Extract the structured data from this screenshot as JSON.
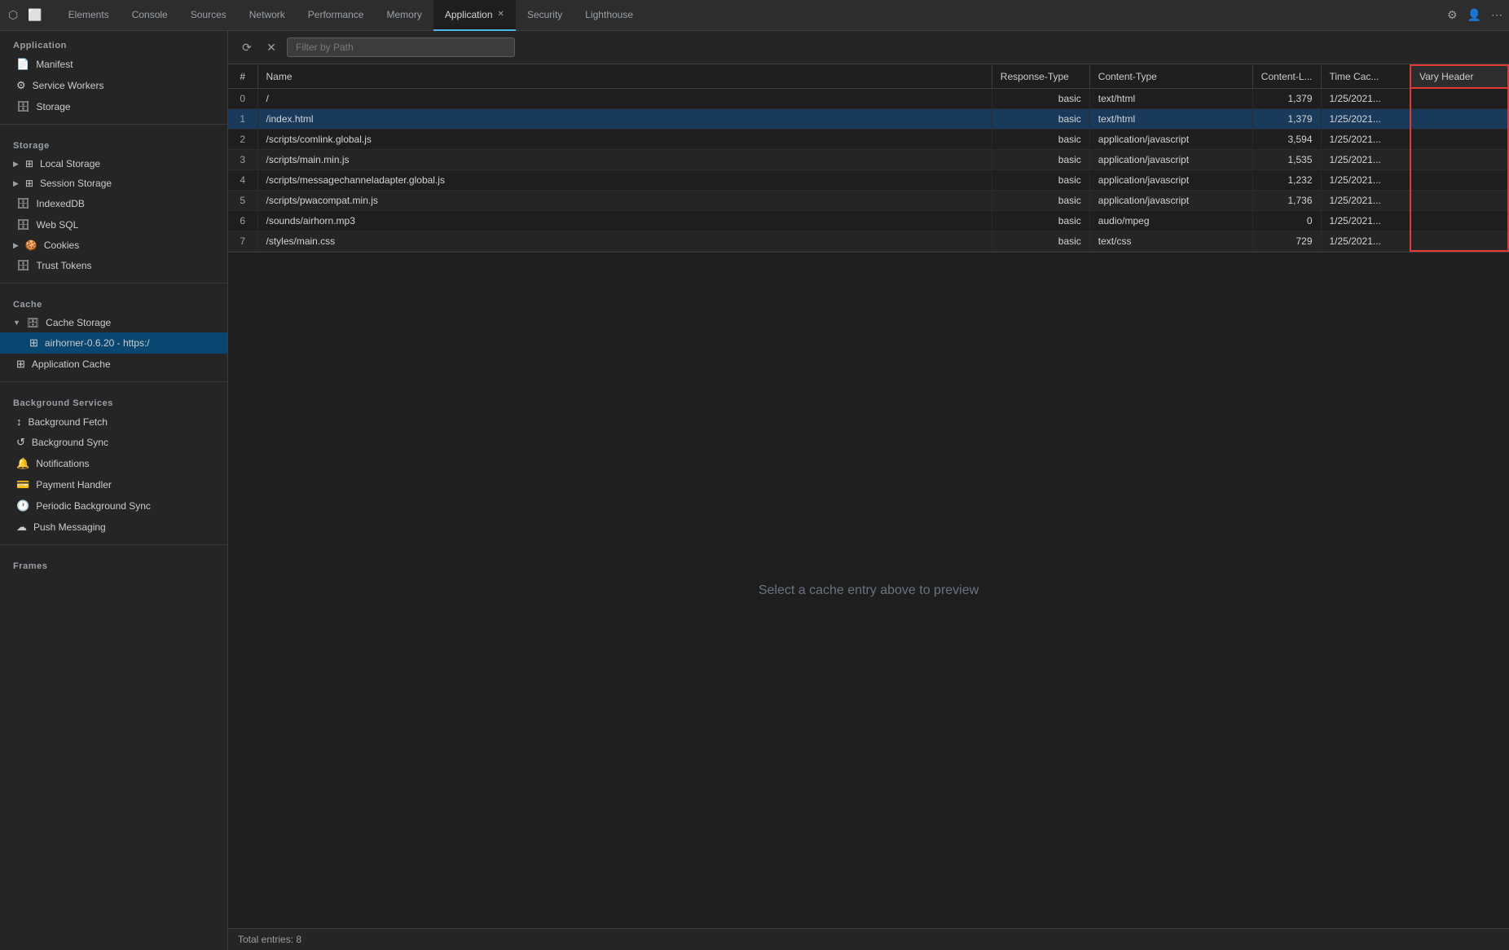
{
  "tabs": {
    "items": [
      {
        "label": "Elements",
        "active": false
      },
      {
        "label": "Console",
        "active": false
      },
      {
        "label": "Sources",
        "active": false
      },
      {
        "label": "Network",
        "active": false
      },
      {
        "label": "Performance",
        "active": false
      },
      {
        "label": "Memory",
        "active": false
      },
      {
        "label": "Application",
        "active": true
      },
      {
        "label": "Security",
        "active": false
      },
      {
        "label": "Lighthouse",
        "active": false
      }
    ],
    "icons": {
      "cursor": "⬡",
      "device": "⬜"
    }
  },
  "toolbar": {
    "refresh_label": "⟳",
    "clear_label": "✕",
    "filter_placeholder": "Filter by Path"
  },
  "sidebar": {
    "application_title": "Application",
    "manifest_label": "Manifest",
    "service_workers_label": "Service Workers",
    "storage_label": "Storage",
    "storage_title": "Storage",
    "local_storage_label": "Local Storage",
    "session_storage_label": "Session Storage",
    "indexeddb_label": "IndexedDB",
    "web_sql_label": "Web SQL",
    "cookies_label": "Cookies",
    "trust_tokens_label": "Trust Tokens",
    "cache_title": "Cache",
    "cache_storage_label": "Cache Storage",
    "cache_storage_item_label": "airhorner-0.6.20 - https:/",
    "application_cache_label": "Application Cache",
    "background_services_title": "Background Services",
    "background_fetch_label": "Background Fetch",
    "background_sync_label": "Background Sync",
    "notifications_label": "Notifications",
    "payment_handler_label": "Payment Handler",
    "periodic_bg_sync_label": "Periodic Background Sync",
    "push_messaging_label": "Push Messaging",
    "frames_title": "Frames"
  },
  "table": {
    "headers": [
      "#",
      "Name",
      "Response-Type",
      "Content-Type",
      "Content-L...",
      "Time Cac...",
      "Vary Header"
    ],
    "rows": [
      {
        "num": "0",
        "name": "/",
        "response_type": "basic",
        "content_type": "text/html",
        "content_length": "1,379",
        "time_cached": "1/25/2021..."
      },
      {
        "num": "1",
        "name": "/index.html",
        "response_type": "basic",
        "content_type": "text/html",
        "content_length": "1,379",
        "time_cached": "1/25/2021..."
      },
      {
        "num": "2",
        "name": "/scripts/comlink.global.js",
        "response_type": "basic",
        "content_type": "application/javascript",
        "content_length": "3,594",
        "time_cached": "1/25/2021..."
      },
      {
        "num": "3",
        "name": "/scripts/main.min.js",
        "response_type": "basic",
        "content_type": "application/javascript",
        "content_length": "1,535",
        "time_cached": "1/25/2021..."
      },
      {
        "num": "4",
        "name": "/scripts/messagechanneladapter.global.js",
        "response_type": "basic",
        "content_type": "application/javascript",
        "content_length": "1,232",
        "time_cached": "1/25/2021..."
      },
      {
        "num": "5",
        "name": "/scripts/pwacompat.min.js",
        "response_type": "basic",
        "content_type": "application/javascript",
        "content_length": "1,736",
        "time_cached": "1/25/2021..."
      },
      {
        "num": "6",
        "name": "/sounds/airhorn.mp3",
        "response_type": "basic",
        "content_type": "audio/mpeg",
        "content_length": "0",
        "time_cached": "1/25/2021..."
      },
      {
        "num": "7",
        "name": "/styles/main.css",
        "response_type": "basic",
        "content_type": "text/css",
        "content_length": "729",
        "time_cached": "1/25/2021..."
      }
    ]
  },
  "preview": {
    "empty_text": "Select a cache entry above to preview"
  },
  "footer": {
    "total_label": "Total entries: 8"
  },
  "colors": {
    "vary_border": "#e53935",
    "active_row": "#1a3a5c"
  }
}
